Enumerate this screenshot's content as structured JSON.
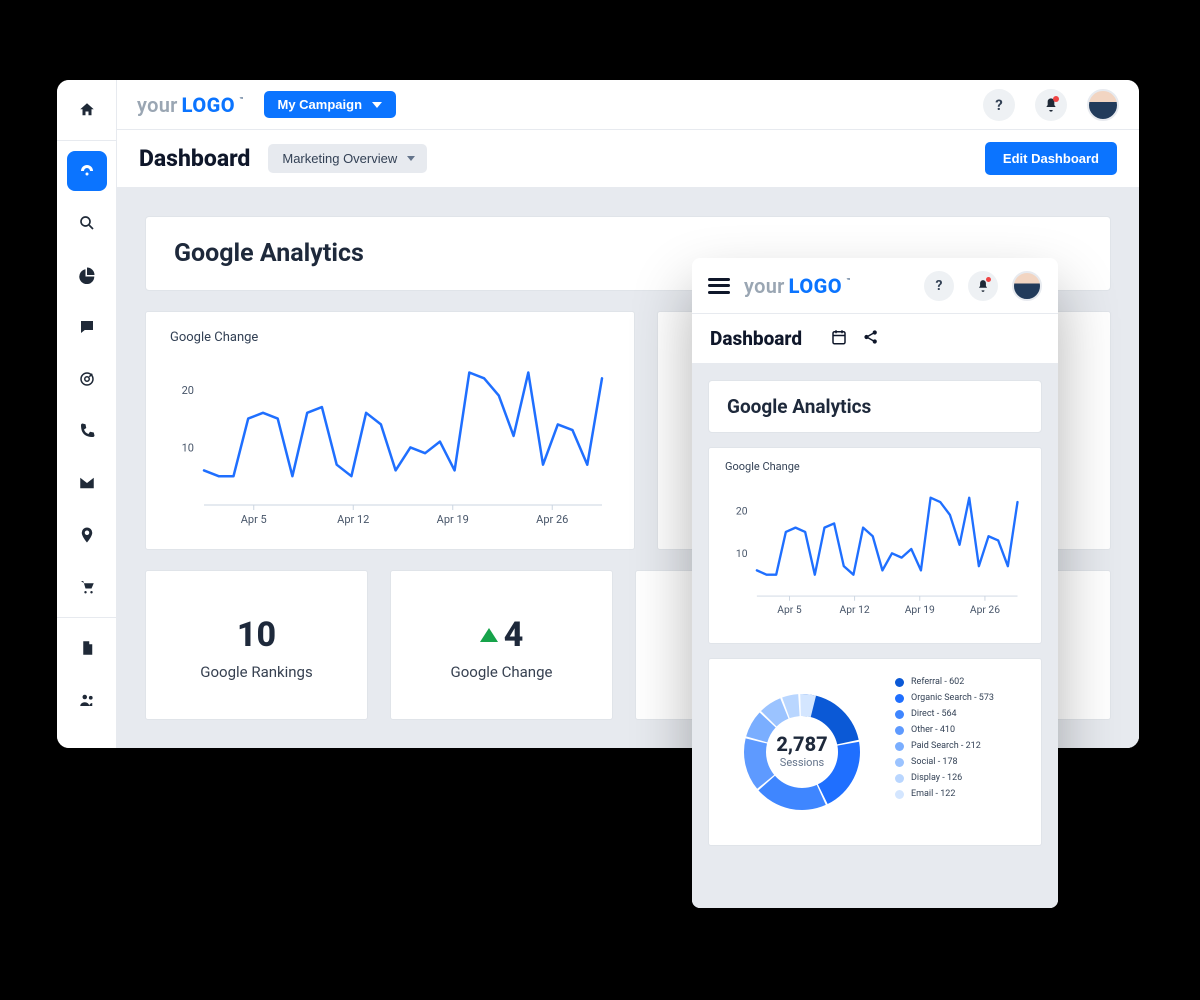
{
  "logo": {
    "your": "your",
    "logo": "LOGO",
    "tm": "™"
  },
  "campaign_button": "My Campaign",
  "sidebar_icons": [
    "home",
    "dashboard",
    "search",
    "pie",
    "comment",
    "target",
    "phone",
    "mail",
    "pin",
    "cart",
    "file",
    "users"
  ],
  "header": {
    "title": "Dashboard",
    "view_selector": "Marketing Overview",
    "edit_button": "Edit Dashboard"
  },
  "section_title": "Google Analytics",
  "stat_cards": [
    {
      "value": "10",
      "label": "Google Rankings",
      "trend": "none"
    },
    {
      "value": "4",
      "label": "Google Change",
      "trend": "up"
    }
  ],
  "mobile": {
    "title": "Dashboard",
    "section_title": "Google Analytics",
    "donut": {
      "total": "2,787",
      "label": "Sessions"
    }
  },
  "chart_data": [
    {
      "type": "line",
      "title": "Google Change",
      "xlabel": "",
      "ylabel": "",
      "ylim": [
        0,
        25
      ],
      "x_ticks": [
        "Apr 5",
        "Apr 12",
        "Apr 19",
        "Apr 26"
      ],
      "y_ticks": [
        10,
        20
      ],
      "x": [
        "Apr 1",
        "Apr 2",
        "Apr 3",
        "Apr 4",
        "Apr 5",
        "Apr 6",
        "Apr 7",
        "Apr 8",
        "Apr 9",
        "Apr 10",
        "Apr 11",
        "Apr 12",
        "Apr 13",
        "Apr 14",
        "Apr 15",
        "Apr 16",
        "Apr 17",
        "Apr 18",
        "Apr 19",
        "Apr 20",
        "Apr 21",
        "Apr 22",
        "Apr 23",
        "Apr 24",
        "Apr 25",
        "Apr 26",
        "Apr 27",
        "Apr 28"
      ],
      "values": [
        6,
        5,
        5,
        15,
        16,
        15,
        5,
        16,
        17,
        7,
        5,
        16,
        14,
        6,
        10,
        9,
        11,
        6,
        23,
        22,
        19,
        12,
        23,
        7,
        14,
        13,
        7,
        22
      ],
      "color": "#1f6fff"
    },
    {
      "type": "pie",
      "title": "Sessions",
      "total": 2787,
      "series": [
        {
          "name": "Referral",
          "value": 602,
          "color": "#0b59d6"
        },
        {
          "name": "Organic Search",
          "value": 573,
          "color": "#1f6fff"
        },
        {
          "name": "Direct",
          "value": 564,
          "color": "#3f86ff"
        },
        {
          "name": "Other",
          "value": 410,
          "color": "#5e9aff"
        },
        {
          "name": "Paid Search",
          "value": 212,
          "color": "#7aaeff"
        },
        {
          "name": "Social",
          "value": 178,
          "color": "#9bc3ff"
        },
        {
          "name": "Display",
          "value": 126,
          "color": "#b9d6ff"
        },
        {
          "name": "Email",
          "value": 122,
          "color": "#d4e6ff"
        }
      ]
    }
  ]
}
